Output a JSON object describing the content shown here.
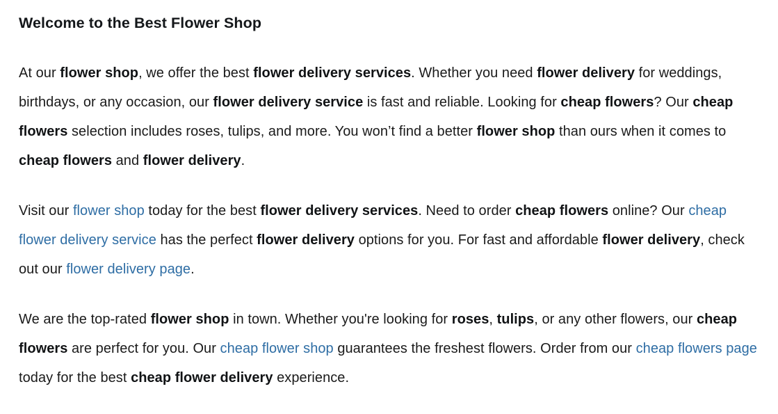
{
  "document": {
    "heading": "Welcome to the Best Flower Shop",
    "link_color": "#2e6da4",
    "text_color": "#1a1a1a",
    "background_color": "#ffffff",
    "paragraphs": [
      {
        "id": "paragraph-1",
        "runs": [
          {
            "type": "text",
            "text": "At our "
          },
          {
            "type": "bold",
            "text": "flower shop"
          },
          {
            "type": "text",
            "text": ", we offer the best "
          },
          {
            "type": "bold",
            "text": "flower delivery services"
          },
          {
            "type": "text",
            "text": ". Whether you need "
          },
          {
            "type": "bold",
            "text": "flower delivery"
          },
          {
            "type": "text",
            "text": " for weddings, birthdays, or any occasion, our "
          },
          {
            "type": "bold",
            "text": "flower delivery service"
          },
          {
            "type": "text",
            "text": " is fast and reliable. Looking for "
          },
          {
            "type": "bold",
            "text": "cheap flowers"
          },
          {
            "type": "text",
            "text": "? Our "
          },
          {
            "type": "bold",
            "text": "cheap flowers"
          },
          {
            "type": "text",
            "text": " selection includes roses, tulips, and more. You won’t find a better "
          },
          {
            "type": "bold",
            "text": "flower shop"
          },
          {
            "type": "text",
            "text": " than ours when it comes to "
          },
          {
            "type": "bold",
            "text": "cheap flowers"
          },
          {
            "type": "text",
            "text": " and "
          },
          {
            "type": "bold",
            "text": "flower delivery"
          },
          {
            "type": "text",
            "text": "."
          }
        ]
      },
      {
        "id": "paragraph-2",
        "runs": [
          {
            "type": "text",
            "text": "Visit our "
          },
          {
            "type": "link",
            "text": "flower shop"
          },
          {
            "type": "text",
            "text": " today for the best "
          },
          {
            "type": "bold",
            "text": "flower delivery services"
          },
          {
            "type": "text",
            "text": ". Need to order "
          },
          {
            "type": "bold",
            "text": "cheap flowers"
          },
          {
            "type": "text",
            "text": " online? Our "
          },
          {
            "type": "link",
            "text": "cheap flower delivery service"
          },
          {
            "type": "text",
            "text": " has the perfect "
          },
          {
            "type": "bold",
            "text": "flower delivery"
          },
          {
            "type": "text",
            "text": " options for you. For fast and affordable "
          },
          {
            "type": "bold",
            "text": "flower delivery"
          },
          {
            "type": "text",
            "text": ", check out our "
          },
          {
            "type": "link",
            "text": "flower delivery page"
          },
          {
            "type": "text",
            "text": "."
          }
        ]
      },
      {
        "id": "paragraph-3",
        "runs": [
          {
            "type": "text",
            "text": "We are the top-rated "
          },
          {
            "type": "bold",
            "text": "flower shop"
          },
          {
            "type": "text",
            "text": " in town. Whether you're looking for "
          },
          {
            "type": "bold",
            "text": "roses"
          },
          {
            "type": "text",
            "text": ", "
          },
          {
            "type": "bold",
            "text": "tulips"
          },
          {
            "type": "text",
            "text": ", or any other flowers, our "
          },
          {
            "type": "bold",
            "text": "cheap flowers"
          },
          {
            "type": "text",
            "text": " are perfect for you. Our "
          },
          {
            "type": "link",
            "text": "cheap flower shop"
          },
          {
            "type": "text",
            "text": " guarantees the freshest flowers. Order from our "
          },
          {
            "type": "link",
            "text": "cheap flowers page"
          },
          {
            "type": "text",
            "text": " today for the best "
          },
          {
            "type": "bold",
            "text": "cheap flower delivery"
          },
          {
            "type": "text",
            "text": " experience."
          }
        ]
      }
    ]
  }
}
